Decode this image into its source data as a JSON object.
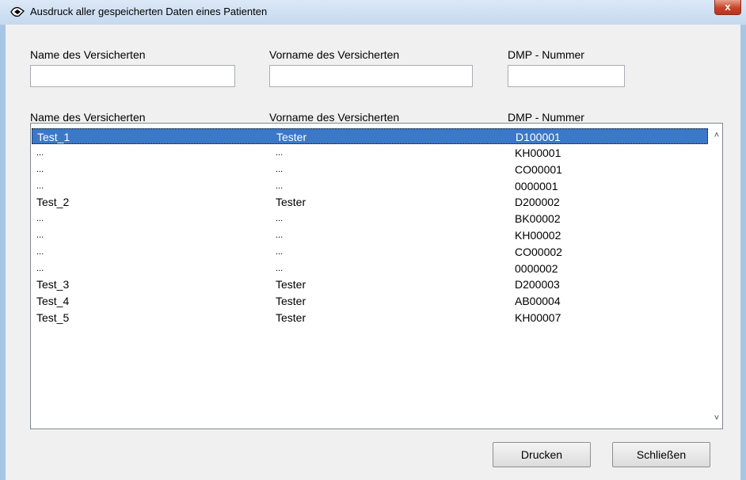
{
  "window": {
    "title": "Ausdruck aller gespeicherten Daten eines Patienten",
    "close_label": "x"
  },
  "filters": {
    "name_label": "Name des Versicherten",
    "vorname_label": "Vorname des Versicherten",
    "dmp_label": "DMP - Nummer",
    "name_value": "",
    "vorname_value": "",
    "dmp_value": ""
  },
  "list": {
    "columns": [
      "Name des Versicherten",
      "Vorname des Versicherten",
      "DMP - Nummer"
    ],
    "rows": [
      [
        "Test_1",
        "Tester",
        "D100001"
      ],
      [
        "...",
        "...",
        "KH00001"
      ],
      [
        "...",
        "...",
        "CO00001"
      ],
      [
        "...",
        "...",
        "0000001"
      ],
      [
        "Test_2",
        "Tester",
        "D200002"
      ],
      [
        "...",
        "...",
        "BK00002"
      ],
      [
        "...",
        "...",
        "KH00002"
      ],
      [
        "...",
        "...",
        "CO00002"
      ],
      [
        "...",
        "...",
        "0000002"
      ],
      [
        "Test_3",
        "Tester",
        "D200003"
      ],
      [
        "Test_4",
        "Tester",
        "AB00004"
      ],
      [
        "Test_5",
        "Tester",
        "KH00007"
      ]
    ],
    "selected_index": 0
  },
  "buttons": {
    "print_label": "Drucken",
    "close_label": "Schließen"
  },
  "colors": {
    "selection": "#3b78c8",
    "window_frame": "#a9c5e4"
  }
}
